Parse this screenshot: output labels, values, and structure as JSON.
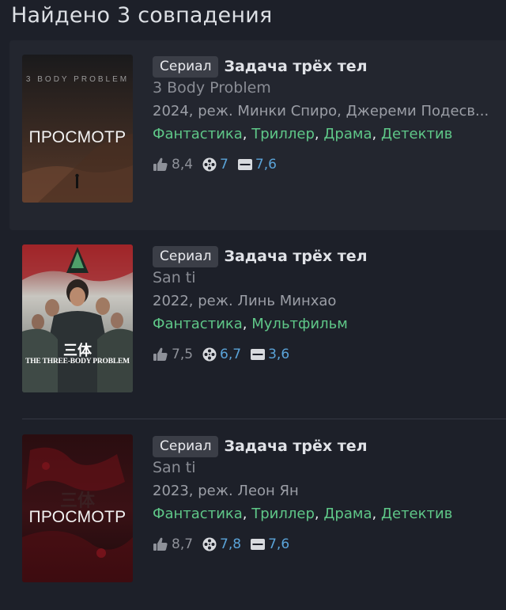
{
  "header": {
    "title": "Найдено 3 совпадения"
  },
  "colors": {
    "background": "#1d2029",
    "genre": "#5fc788",
    "rating_green": "#5fc788",
    "rating_blue": "#5aa3d8"
  },
  "results": [
    {
      "badge": "Сериал",
      "title": "Задача трёх тел",
      "original_title": "3 Body Problem",
      "meta": "2024, реж. Минки Спиро, Джереми Подесв...",
      "genres": [
        "Фантастика",
        "Триллер",
        "Драма",
        "Детектив"
      ],
      "poster": {
        "overlay": "ПРОСМОТР",
        "small_text": "3 BODY PROBLEM"
      },
      "ratings": {
        "likes": "8,4",
        "kp": "7",
        "imdb": "7,6"
      }
    },
    {
      "badge": "Сериал",
      "title": "Задача трёх тел",
      "original_title": "San ti",
      "meta": "2022, реж. Линь Минхао",
      "genres": [
        "Фантастика",
        "Мультфильм"
      ],
      "poster": {
        "caption_cn": "三体",
        "caption": "THE THREE-BODY PROBLEM"
      },
      "ratings": {
        "likes": "7,5",
        "kp": "6,7",
        "imdb": "3,6"
      }
    },
    {
      "badge": "Сериал",
      "title": "Задача трёх тел",
      "original_title": "San ti",
      "meta": "2023, реж. Леон Ян",
      "genres": [
        "Фантастика",
        "Триллер",
        "Драма",
        "Детектив"
      ],
      "poster": {
        "overlay": "ПРОСМОТР",
        "caption_cn": "三体"
      },
      "ratings": {
        "likes": "8,7",
        "kp": "7,8",
        "imdb": "7,6"
      }
    }
  ]
}
